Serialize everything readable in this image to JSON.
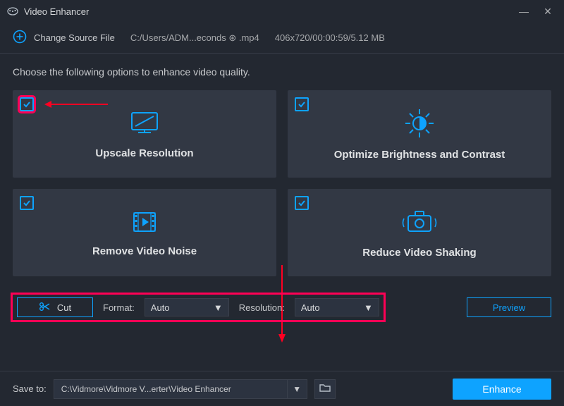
{
  "window": {
    "title": "Video Enhancer"
  },
  "topbar": {
    "change_source": "Change Source File",
    "path": "C:/Users/ADM...econds ⊛ .mp4",
    "meta": "406x720/00:00:59/5.12 MB"
  },
  "instruction": "Choose the following options to enhance video quality.",
  "cards": [
    {
      "label": "Upscale Resolution",
      "checked": true
    },
    {
      "label": "Optimize Brightness and Contrast",
      "checked": true
    },
    {
      "label": "Remove Video Noise",
      "checked": true
    },
    {
      "label": "Reduce Video Shaking",
      "checked": true
    }
  ],
  "controls": {
    "cut": "Cut",
    "format_label": "Format:",
    "format_value": "Auto",
    "resolution_label": "Resolution:",
    "resolution_value": "Auto",
    "preview": "Preview"
  },
  "footer": {
    "save_to_label": "Save to:",
    "save_path": "C:\\Vidmore\\Vidmore V...erter\\Video Enhancer",
    "enhance": "Enhance"
  }
}
